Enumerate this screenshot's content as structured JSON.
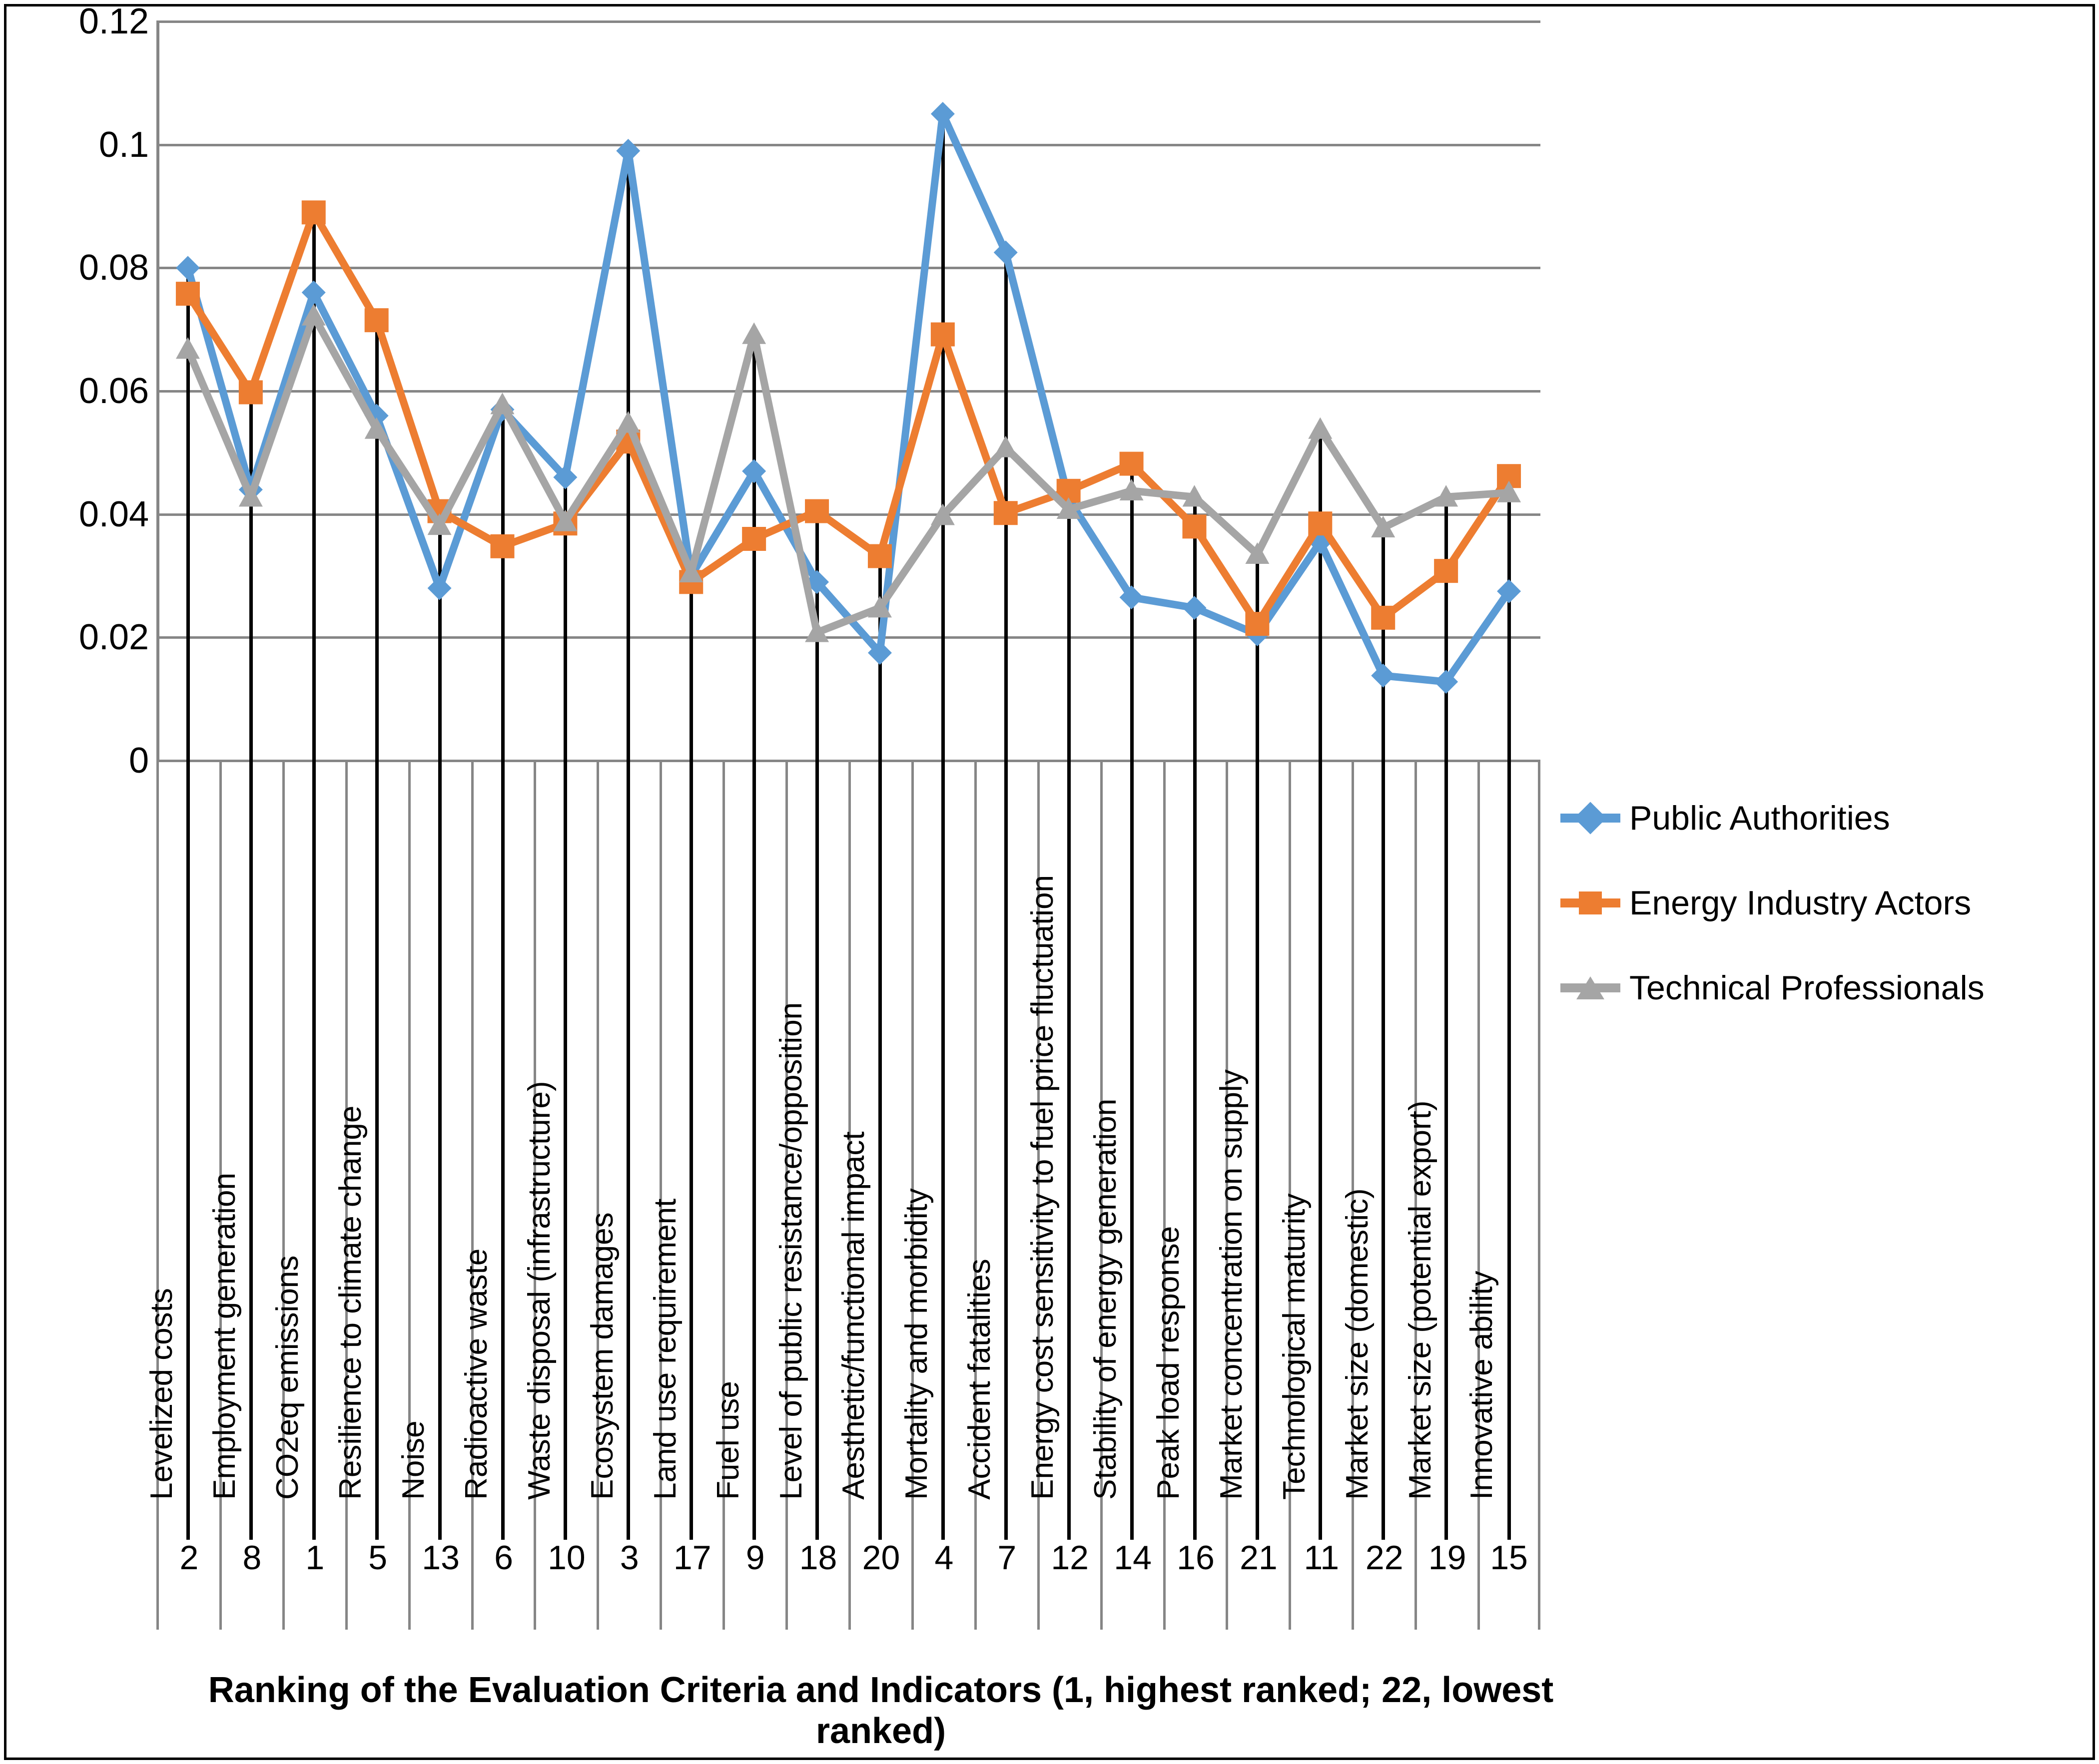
{
  "chart_data": {
    "type": "line",
    "title": "",
    "xlabel": "Ranking of the Evaluation Criteria and Indicators (1, highest ranked; 22, lowest ranked)",
    "ylabel": "",
    "ylim": [
      0,
      0.12
    ],
    "ytick_labels": [
      "0.12",
      "0.1",
      "0.08",
      "0.06",
      "0.04",
      "0.02",
      "0"
    ],
    "yticks": [
      0.12,
      0.1,
      0.08,
      0.06,
      0.04,
      0.02,
      0
    ],
    "grid": true,
    "legend_position": "right",
    "categories": [
      "Levelized costs",
      "Employment generation",
      "CO2eq emissions",
      "Resilience to climate change",
      "Noise",
      "Radioactive waste",
      "Waste disposal (infrastructure)",
      "Ecosystem damages",
      "Land use requirement",
      "Fuel use",
      "Level of public resistance/opposition",
      "Aesthetic/functional impact",
      "Mortality and morbidity",
      "Accident fatalities",
      "Energy cost sensitivity to fuel price fluctuation",
      "Stability of energy generation",
      "Peak load response",
      "Market concentration on supply",
      "Technological maturity",
      "Market size (domestic)",
      "Market size (potential export)",
      "Innovative ability"
    ],
    "rankings": [
      2,
      8,
      1,
      5,
      13,
      6,
      10,
      3,
      17,
      9,
      18,
      20,
      4,
      7,
      12,
      14,
      16,
      21,
      11,
      22,
      19,
      15
    ],
    "series": [
      {
        "name": "Public Authorities",
        "color": "#5B9BD5",
        "marker": "diamond",
        "values": [
          0.08,
          0.044,
          0.076,
          0.056,
          0.028,
          0.057,
          0.046,
          0.099,
          0.03,
          0.047,
          0.029,
          0.0175,
          0.105,
          0.0825,
          0.0425,
          0.0265,
          0.0248,
          0.0205,
          0.0355,
          0.0138,
          0.0128,
          0.0275
        ]
      },
      {
        "name": "Energy Industry Actors",
        "color": "#ED7D31",
        "marker": "square",
        "values": [
          0.0758,
          0.0598,
          0.089,
          0.0715,
          0.0405,
          0.0348,
          0.0385,
          0.0518,
          0.029,
          0.036,
          0.0405,
          0.0332,
          0.0692,
          0.0402,
          0.0438,
          0.0482,
          0.038,
          0.0222,
          0.0385,
          0.0232,
          0.0308,
          0.0462
        ]
      },
      {
        "name": "Technical Professionals",
        "color": "#A5A5A5",
        "marker": "triangle",
        "values": [
          0.0668,
          0.0428,
          0.0722,
          0.0538,
          0.0382,
          0.0578,
          0.0388,
          0.0548,
          0.0305,
          0.0692,
          0.0208,
          0.0248,
          0.0398,
          0.0508,
          0.0408,
          0.0438,
          0.0428,
          0.0335,
          0.0538,
          0.0378,
          0.0428,
          0.0435
        ]
      }
    ]
  },
  "legend": {
    "items": [
      {
        "label": "Public Authorities"
      },
      {
        "label": "Energy Industry Actors"
      },
      {
        "label": "Technical Professionals"
      }
    ]
  }
}
